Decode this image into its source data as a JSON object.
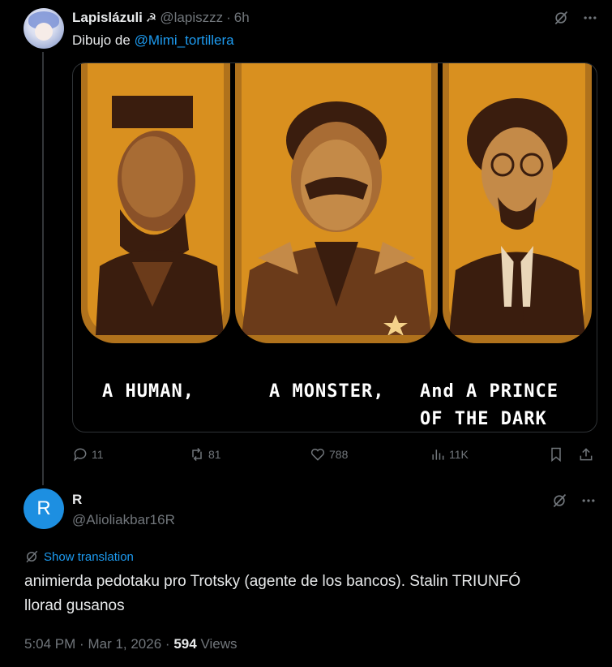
{
  "tweet": {
    "author_name": "Lapislázuli",
    "badge_glyph": "☭",
    "handle": "@lapiszzz",
    "separator": "·",
    "time": "6h",
    "text_prefix": "Dibujo de ",
    "mention": "@Mimi_tortillera",
    "image_captions": [
      "A HUMAN,",
      "A MONSTER,",
      "And A PRINCE",
      "OF THE DARK"
    ],
    "stats": {
      "replies": "11",
      "reposts": "81",
      "likes": "788",
      "views": "11K"
    }
  },
  "reply": {
    "avatar_letter": "R",
    "author_name": "R",
    "handle": "@Alioliakbar16R",
    "show_translation": "Show translation",
    "text_line1": "animierda pedotaku pro Trotsky (agente de los bancos). Stalin TRIUNFÓ",
    "text_line2": "llorad gusanos",
    "time": "5:04 PM",
    "separator": "·",
    "date": "Mar 1, 2026",
    "separator2": "·",
    "views_count": "594",
    "views_label": "Views"
  },
  "colors": {
    "accent": "#1d9bf0",
    "muted": "#71767b",
    "text": "#e7e9ea",
    "bg": "#000000",
    "panel": "#d9901f"
  },
  "icons": [
    "grok-icon",
    "more-icon",
    "reply-icon",
    "repost-icon",
    "like-icon",
    "views-icon",
    "bookmark-icon",
    "share-icon",
    "translate-icon"
  ]
}
